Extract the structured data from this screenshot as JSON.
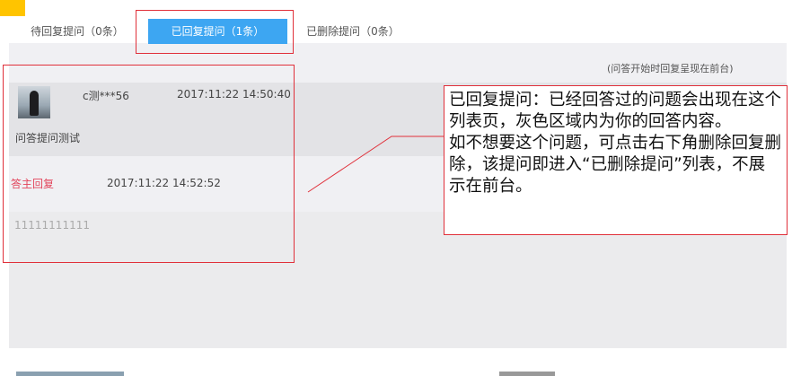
{
  "tabs": {
    "pending": "待回复提问（0条）",
    "replied": "已回复提问（1条）",
    "deleted": "已删除提问（0条）"
  },
  "hint": "(问答开始时回复呈现在前台)",
  "question": {
    "user": "c测***56",
    "time": "2017:11:22 14:50:40",
    "text": "问答提问测试"
  },
  "reply": {
    "label": "答主回复",
    "time": "2017:11:22 14:52:52",
    "text": "11111111111"
  },
  "callout": {
    "line1": "已回复提问：已经回答过的问题会出现在这个列表页，灰色区域内为你的回答内容。",
    "line2": "如不想要这个问题，可点击右下角删除回复删除，该提问即进入“已删除提问”列表，不展示在前台。"
  },
  "colors": {
    "accent_blue": "#3da6f2",
    "annotation_red": "#e0303a",
    "reply_label_pink": "#e2455c",
    "corner_yellow": "#ffc400"
  }
}
